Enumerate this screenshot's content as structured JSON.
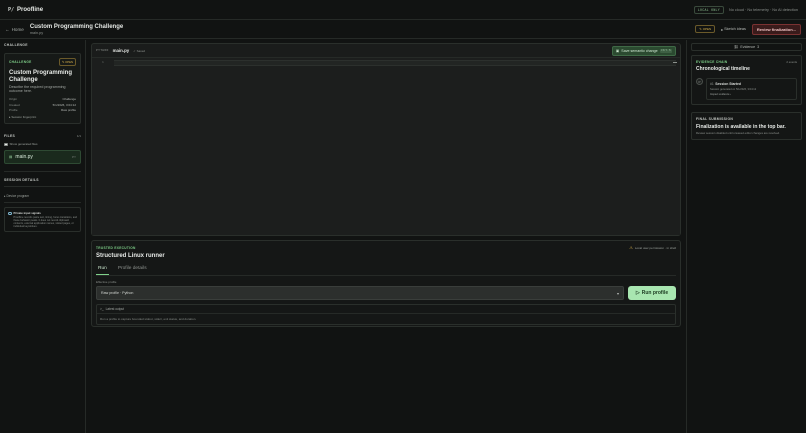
{
  "app": {
    "logo": "P/",
    "name": "Proofline"
  },
  "topbar": {
    "badge": "LOCAL ONLY",
    "privacy": "No cloud · No telemetry · No AI detection"
  },
  "header": {
    "back": "Home",
    "title": "Custom Programming Challenge",
    "file": "main.py",
    "status": "OPEN",
    "sketch": "Sketch ideas",
    "review": "Review finalization..."
  },
  "left": {
    "challenge_section": "CHALLENGE",
    "card_label": "CHALLENGE",
    "card_badge": "OPEN",
    "title": "Custom Programming Challenge",
    "description": "Describe the required programming outcome here.",
    "meta": [
      {
        "k": "Origin",
        "v": "Challenge"
      },
      {
        "k": "Created",
        "v": "5/1/2026, 3:04:12"
      },
      {
        "k": "Profile",
        "v": "Raw profile"
      }
    ],
    "fingerprint_link": "▸ Session fingerprint",
    "files_label": "FILES",
    "files_count": "1/1",
    "show_generated": "Show generated files",
    "file_name": "main.py",
    "file_type": "PY",
    "session_label": "SESSION DETAILS",
    "session_link": "▸ Device program",
    "note_title": "Private input signals",
    "note_body": "Proofline records paste text, timing, focus transitions, and these behavior peaks. It does not record clipboard contents, external application names, visited pages, or individual keystrokes."
  },
  "editor": {
    "lang": "PYTHON",
    "file": "main.py",
    "saved": "Saved",
    "save_btn": "Save semantic change",
    "shortcut": "Ctrl S",
    "line": "1"
  },
  "runner": {
    "label": "TRUSTED EXECUTION",
    "warning": "Local user permission · in shell",
    "title": "Structured Linux runner",
    "tabs": [
      "Run",
      "Profile details"
    ],
    "effective_label": "Effective profile",
    "profile_value": "Raw profile · Python",
    "run_btn": "Run profile",
    "output_head": "Latest output",
    "output_body": "Run a profile to capture bounded stdout, stderr, exit status, and duration."
  },
  "right": {
    "evidence_btn": "Evidence",
    "evidence_count": "3",
    "chain_label": "EVIDENCE CHAIN",
    "events": "2 events",
    "chain_title": "Chronological timeline",
    "tl_dot": "P",
    "tl_index": "#1",
    "tl_title": "Session Started",
    "tl_desc": "Session generated on 5/1/2026, 3:04:12",
    "tl_link": "Inspect evidence",
    "final_label": "FINAL SUBMISSION",
    "final_title": "Finalization is available in the top bar.",
    "final_desc": "Review session disabled until unsaved editor changes are resolved."
  },
  "colors": {
    "accent": "#7fd18a",
    "run": "#a8e6b0",
    "review": "#7a3232",
    "warning": "#d9b24c"
  }
}
